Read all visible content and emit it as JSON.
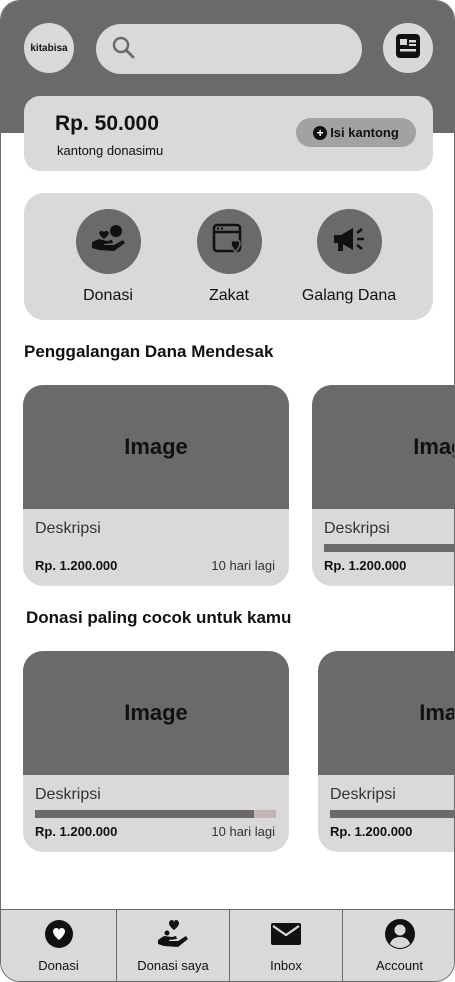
{
  "header": {
    "logo_text": "kitabisa",
    "search_placeholder": "",
    "news_icon": "news-icon"
  },
  "wallet": {
    "amount": "Rp. 50.000",
    "label": "kantong donasimu",
    "topup_label": "Isi kantong",
    "topup_icon": "plus-circle-icon"
  },
  "menu": {
    "items": [
      {
        "label": "Donasi",
        "icon": "donation-hand-icon"
      },
      {
        "label": "Zakat",
        "icon": "calendar-heart-icon"
      },
      {
        "label": "Galang Dana",
        "icon": "megaphone-icon"
      }
    ]
  },
  "urgent": {
    "title": "Penggalangan Dana Mendesak",
    "cards": [
      {
        "image_label": "Image",
        "description": "Deskripsi",
        "amount": "Rp. 1.200.000",
        "days_left": "10 hari lagi"
      },
      {
        "image_label": "Image",
        "description": "Deskripsi",
        "amount": "Rp. 1.200.000",
        "days_left": "",
        "progress": 1.0
      }
    ]
  },
  "recommended": {
    "title": "Donasi paling cocok untuk kamu",
    "cards": [
      {
        "image_label": "Image",
        "description": "Deskripsi",
        "amount": "Rp. 1.200.000",
        "days_left": "10 hari lagi",
        "progress": 0.91
      },
      {
        "image_label": "Image",
        "description": "Deskripsi",
        "amount": "Rp. 1.200.000",
        "days_left": "",
        "progress": 1.0
      }
    ]
  },
  "bottom_nav": {
    "items": [
      {
        "label": "Donasi",
        "icon": "heart-circle-icon"
      },
      {
        "label": "Donasi saya",
        "icon": "hand-heart-icon"
      },
      {
        "label": "Inbox",
        "icon": "envelope-icon"
      },
      {
        "label": "Account",
        "icon": "user-circle-icon"
      }
    ]
  },
  "colors": {
    "header_bg": "#6b6a68",
    "card_bg": "#d9d9d9",
    "image_placeholder": "#6b6a68",
    "progress_track": "#c4b5b5"
  }
}
